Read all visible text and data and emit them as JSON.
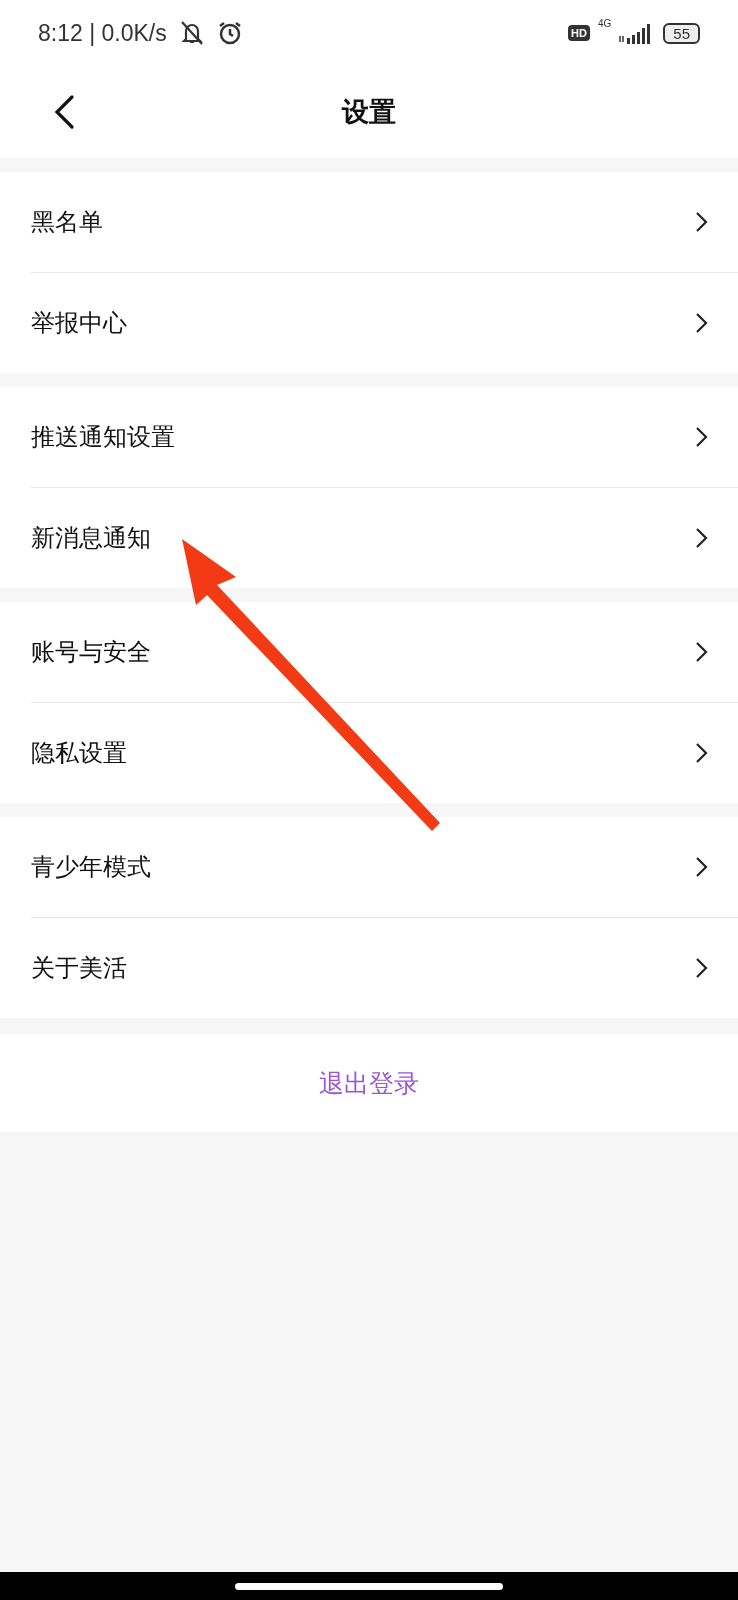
{
  "status_bar": {
    "time": "8:12 | 0.0K/s",
    "hd": "HD",
    "network": "4G",
    "battery": "55"
  },
  "header": {
    "title": "设置"
  },
  "groups": [
    {
      "items": [
        {
          "label": "黑名单"
        },
        {
          "label": "举报中心"
        }
      ]
    },
    {
      "items": [
        {
          "label": "推送通知设置"
        },
        {
          "label": "新消息通知"
        }
      ]
    },
    {
      "items": [
        {
          "label": "账号与安全"
        },
        {
          "label": "隐私设置"
        }
      ]
    },
    {
      "items": [
        {
          "label": "青少年模式"
        },
        {
          "label": "关于美活"
        }
      ]
    }
  ],
  "logout": {
    "label": "退出登录"
  }
}
